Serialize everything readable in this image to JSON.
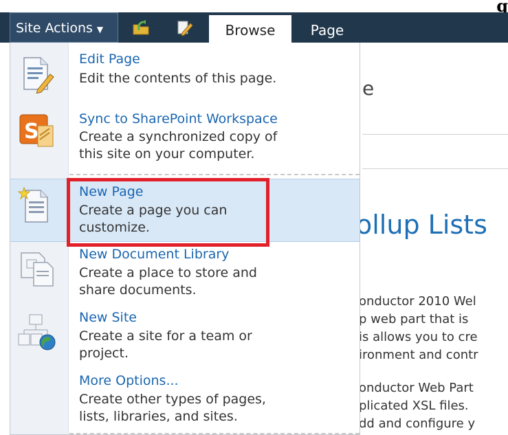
{
  "ribbon": {
    "site_actions_label": "Site Actions",
    "tabs": [
      {
        "label": "Browse"
      },
      {
        "label": "Page"
      }
    ],
    "top_cut_text": "g"
  },
  "menu": {
    "items": [
      {
        "title": "Edit Page",
        "desc": "Edit the contents of this page.",
        "icon": "edit-page-icon"
      },
      {
        "title": "Sync to SharePoint Workspace",
        "desc": "Create a synchronized copy of\nthis site on your computer.",
        "icon": "sharepoint-workspace-icon"
      },
      {
        "title": "New Page",
        "desc": "Create a page you can\ncustomize.",
        "icon": "new-page-icon"
      },
      {
        "title": "New Document Library",
        "desc": "Create a place to store and\nshare documents.",
        "icon": "document-library-icon"
      },
      {
        "title": "New Site",
        "desc": "Create a site for a team or\nproject.",
        "icon": "new-site-icon"
      },
      {
        "title": "More Options...",
        "desc": "Create other types of pages,\nlists, libraries, and sites.",
        "icon": "more-options-icon"
      }
    ]
  },
  "background": {
    "cut_letter": "e",
    "heading": "ollup Lists",
    "para1": "onductor 2010 Wel\np web part that is\nis allows you to cre\nironment and contr",
    "para2": "onductor Web Part\nplicated XSL files.\ndd and configure y"
  },
  "colors": {
    "ribbon_bg": "#21374c",
    "link_blue": "#1a66b0",
    "highlight_bg": "#d9e8f7",
    "callout_red": "#e2202a"
  }
}
